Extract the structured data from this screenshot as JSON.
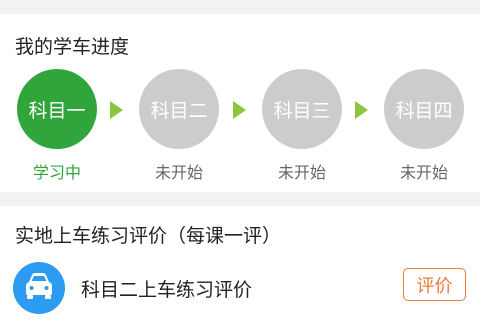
{
  "progress": {
    "title": "我的学车进度",
    "steps": [
      {
        "label": "科目一",
        "status": "学习中"
      },
      {
        "label": "科目二",
        "status": "未开始"
      },
      {
        "label": "科目三",
        "status": "未开始"
      },
      {
        "label": "科目四",
        "status": "未开始"
      }
    ]
  },
  "evaluation": {
    "title": "实地上车练习评价（每课一评）",
    "item_label": "科目二上车练习评价",
    "button_label": "评价"
  },
  "colors": {
    "active_green": "#2fa53b",
    "inactive_gray": "#cccccc",
    "arrow_green": "#8cc63e",
    "accent_orange": "#f07a3a",
    "icon_blue": "#2b9cf2"
  },
  "icons": {
    "eval_item": "car-icon",
    "step_separator": "arrow-right-icon"
  }
}
